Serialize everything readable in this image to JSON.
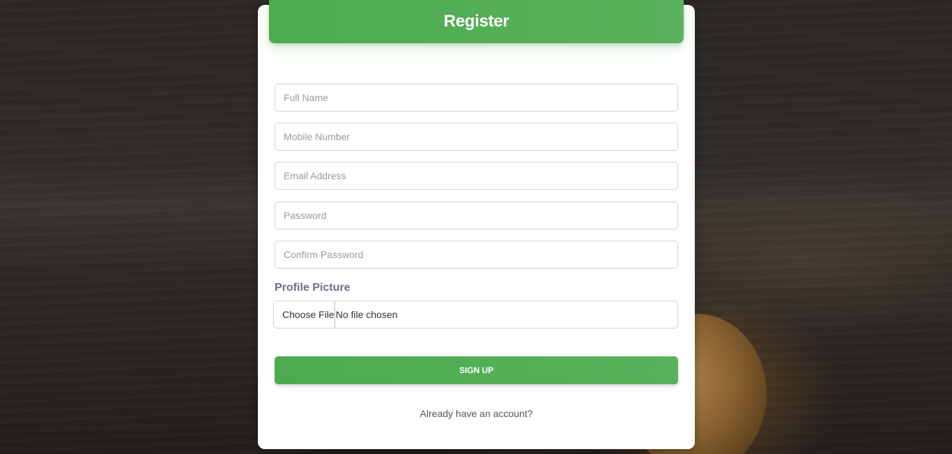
{
  "form": {
    "title": "Register",
    "fields": [
      {
        "placeholder": "Full Name",
        "value": ""
      },
      {
        "placeholder": "Mobile Number",
        "value": ""
      },
      {
        "placeholder": "Email Address",
        "value": ""
      },
      {
        "placeholder": "Password",
        "value": ""
      },
      {
        "placeholder": "Confirm Password",
        "value": ""
      }
    ],
    "profile_label": "Profile Picture",
    "file_button_label": "Choose File",
    "file_status": "No file chosen",
    "submit_label": "SIGN UP",
    "login_link": "Already have an account?"
  },
  "colors": {
    "accent": "#4caa4f",
    "card": "#ffffff",
    "background": "#2b2825"
  }
}
